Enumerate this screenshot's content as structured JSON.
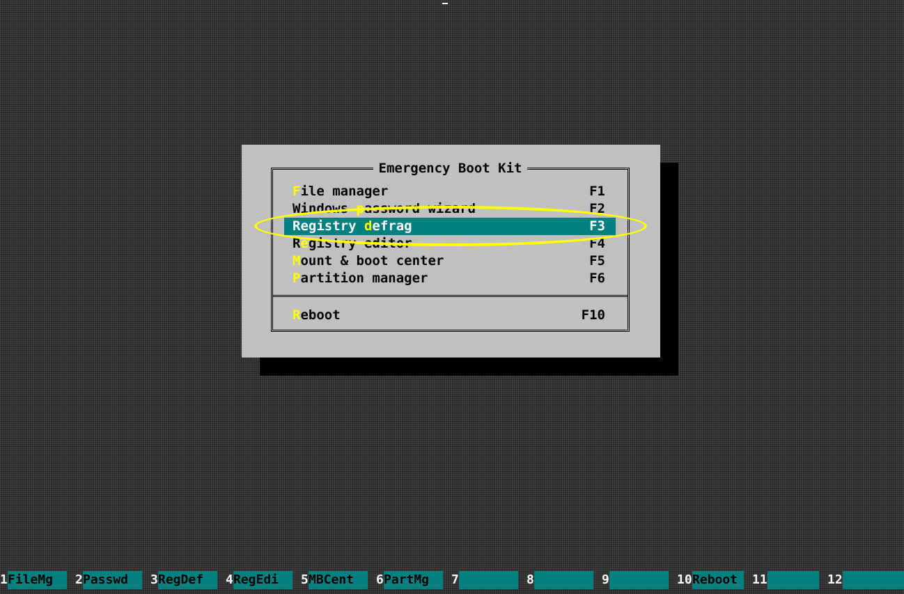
{
  "dialog": {
    "title": "Emergency Boot Kit",
    "items": [
      {
        "hot": "F",
        "rest": "ile manager",
        "key": "F1"
      },
      {
        "pre": "Windows ",
        "hot": "p",
        "rest": "assword wizard",
        "key": "F2"
      },
      {
        "pre": "Registry ",
        "hot": "d",
        "rest": "efrag",
        "key": "F3",
        "selected": true
      },
      {
        "pre": "R",
        "hot": "e",
        "rest": "gistry editor",
        "key": "F4"
      },
      {
        "hot": "M",
        "rest": "ount & boot center",
        "key": "F5"
      },
      {
        "hot": "P",
        "rest": "artition manager",
        "key": "F6"
      }
    ],
    "reboot": {
      "hot": "R",
      "rest": "eboot",
      "key": "F10"
    }
  },
  "fkeys": [
    {
      "num": "1",
      "label": "FileMg"
    },
    {
      "num": "2",
      "label": "Passwd"
    },
    {
      "num": "3",
      "label": "RegDef"
    },
    {
      "num": "4",
      "label": "RegEdi"
    },
    {
      "num": "5",
      "label": "MBCent"
    },
    {
      "num": "6",
      "label": "PartMg"
    },
    {
      "num": "7",
      "label": ""
    },
    {
      "num": "8",
      "label": ""
    },
    {
      "num": "9",
      "label": ""
    },
    {
      "num": "10",
      "label": "Reboot"
    },
    {
      "num": "11",
      "label": ""
    },
    {
      "num": "12",
      "label": ""
    }
  ],
  "colors": {
    "selected_bg": "#008080",
    "hotkey": "#ffff00",
    "dialog_bg": "#c0c0c0",
    "annotation_ring": "#ffff00"
  }
}
